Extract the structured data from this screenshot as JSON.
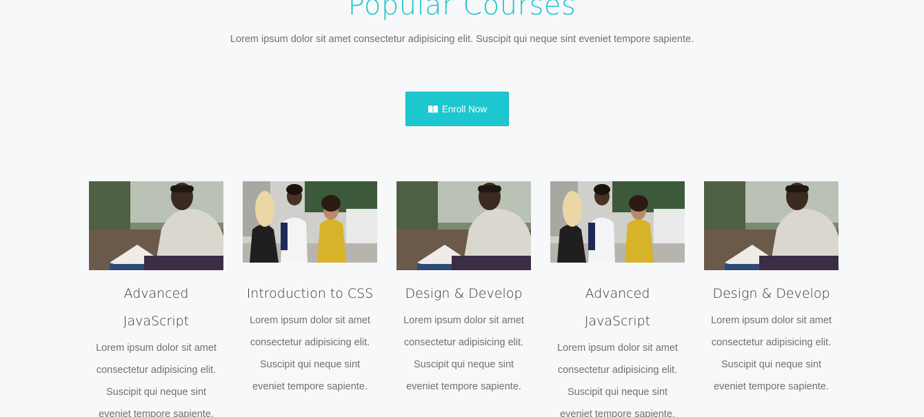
{
  "section": {
    "title": "Popular Courses",
    "subtitle": "Lorem ipsum dolor sit amet consectetur adipisicing elit. Suscipit qui neque sint eveniet tempore sapiente."
  },
  "enroll": {
    "label": "Enroll Now",
    "icon": "book-icon"
  },
  "courses": [
    {
      "title": "Advanced JavaScript",
      "description": "Lorem ipsum dolor sit amet consectetur adipisicing elit. Suscipit qui neque sint eveniet tempore sapiente.",
      "image": "man-reading-photo"
    },
    {
      "title": "Introduction to CSS",
      "description": "Lorem ipsum dolor sit amet consectetur adipisicing elit. Suscipit qui neque sint eveniet tempore sapiente.",
      "image": "students-talking-photo"
    },
    {
      "title": "Design & Develop",
      "description": "Lorem ipsum dolor sit amet consectetur adipisicing elit. Suscipit qui neque sint eveniet tempore sapiente.",
      "image": "man-reading-photo"
    },
    {
      "title": "Advanced JavaScript",
      "description": "Lorem ipsum dolor sit amet consectetur adipisicing elit. Suscipit qui neque sint eveniet tempore sapiente.",
      "image": "students-talking-photo"
    },
    {
      "title": "Design & Develop",
      "description": "Lorem ipsum dolor sit amet consectetur adipisicing elit. Suscipit qui neque sint eveniet tempore sapiente.",
      "image": "man-reading-photo"
    }
  ],
  "colors": {
    "accent": "#1cc7d0",
    "background": "#f7f8fa",
    "heading": "#333333",
    "body_text": "#707070"
  }
}
